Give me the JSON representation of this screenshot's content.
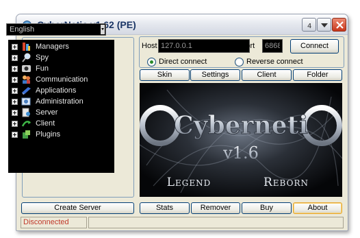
{
  "window": {
    "title": "CyberNetic v1.62 (PE)"
  },
  "language": {
    "selected": "English"
  },
  "tree": {
    "items": [
      {
        "label": "Managers",
        "icon": "managers-icon"
      },
      {
        "label": "Spy",
        "icon": "spy-icon"
      },
      {
        "label": "Fun",
        "icon": "fun-icon"
      },
      {
        "label": "Communication",
        "icon": "communication-icon"
      },
      {
        "label": "Applications",
        "icon": "applications-icon"
      },
      {
        "label": "Administration",
        "icon": "administration-icon"
      },
      {
        "label": "Server",
        "icon": "server-icon"
      },
      {
        "label": "Client",
        "icon": "client-icon"
      },
      {
        "label": "Plugins",
        "icon": "plugins-icon"
      }
    ]
  },
  "connection": {
    "host_label": "Host",
    "host_value": "127.0.0.1",
    "port_label": "Port",
    "port_value": "6868",
    "connect_label": "Connect",
    "direct_label": "Direct connect",
    "reverse_label": "Reverse connect",
    "mode_selected": "direct"
  },
  "tabs": [
    "Skin",
    "Settings",
    "Client",
    "Folder"
  ],
  "banner": {
    "logo_text": "Cyberneti",
    "version_text": "v1.6",
    "left_word": "Legend",
    "right_word": "Reborn"
  },
  "bottom": {
    "create_server_label": "Create Server",
    "buttons": [
      "Stats",
      "Remover",
      "Buy",
      "About"
    ]
  },
  "status": {
    "text": "Disconnected"
  },
  "colors": {
    "accent": "#1a3565",
    "status_text": "#c0392b",
    "banner_bg": "#000000"
  }
}
